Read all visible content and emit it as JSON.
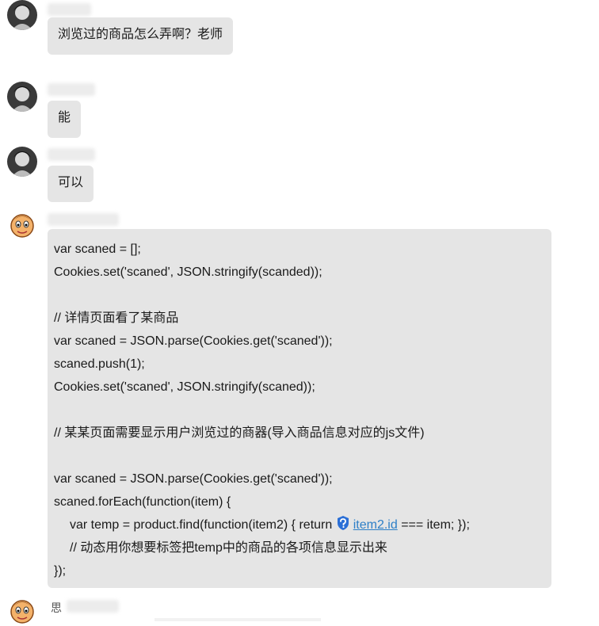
{
  "messages": [
    {
      "text": "浏览过的商品怎么弄啊？老师"
    },
    {
      "text": "能"
    },
    {
      "text": "可以"
    }
  ],
  "code_message": {
    "lines": [
      "var scaned = [];",
      "Cookies.set('scaned', JSON.stringify(scanded));",
      "",
      "// 详情页面看了某商品",
      "var scaned = JSON.parse(Cookies.get('scaned'));",
      "scaned.push(1);",
      "Cookies.set('scaned', JSON.stringify(scaned));",
      "",
      "// 某某页面需要显示用户浏览过的商器(导入商品信息对应的js文件)",
      "",
      "var scaned = JSON.parse(Cookies.get('scaned'));",
      "scaned.forEach(function(item) {"
    ],
    "line12_prefix": "var temp = product.find(function(item2) { return ",
    "line12_link": "item2.id",
    "line12_suffix": " === item; });",
    "line13": "// 动态用你想要标签把temp中的商品的各项信息显示出来",
    "line14": "});"
  },
  "last_sender": {
    "name_prefix": "思"
  },
  "colors": {
    "bubble": "#e5e5e5",
    "link": "#2d7fc7",
    "shield": "#2b6fd6"
  },
  "icons": {
    "shield": "shield-check-icon",
    "avatar_student": "avatar-icon",
    "avatar_teacher": "cartoon-face-icon"
  }
}
